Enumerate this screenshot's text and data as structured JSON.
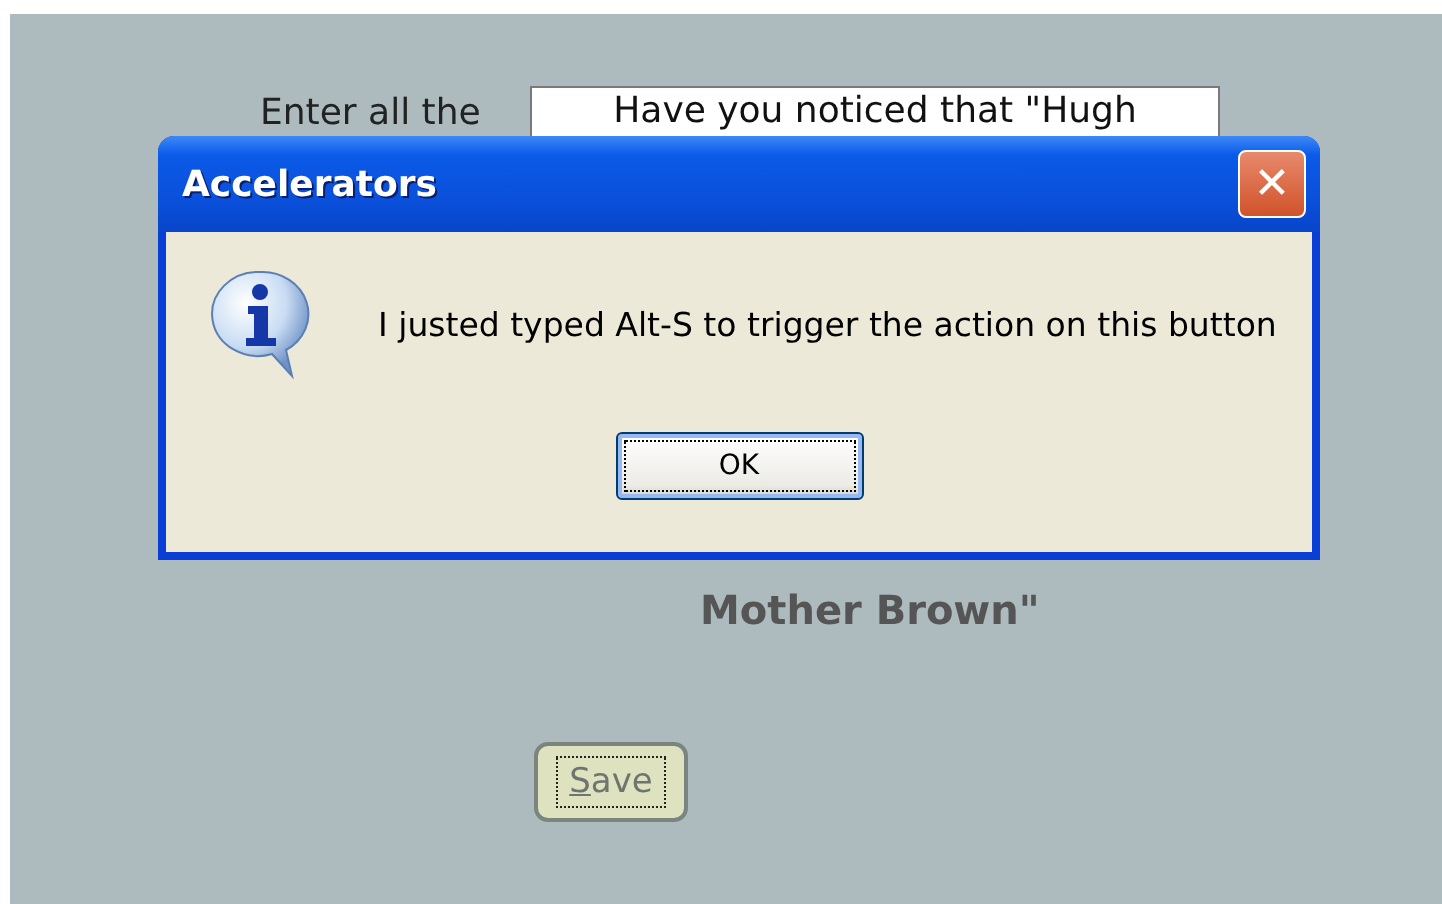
{
  "form": {
    "label": "Enter all the",
    "text_value": "Have you noticed that \"Hugh",
    "caption": "Mother Brown\"",
    "save_button": {
      "label": "Save",
      "underline_first": true
    }
  },
  "dialog": {
    "title": "Accelerators",
    "close": "✕",
    "message": "I justed typed Alt-S to trigger the action on this button",
    "buttons": [
      {
        "label": "OK",
        "focused": true
      }
    ]
  }
}
